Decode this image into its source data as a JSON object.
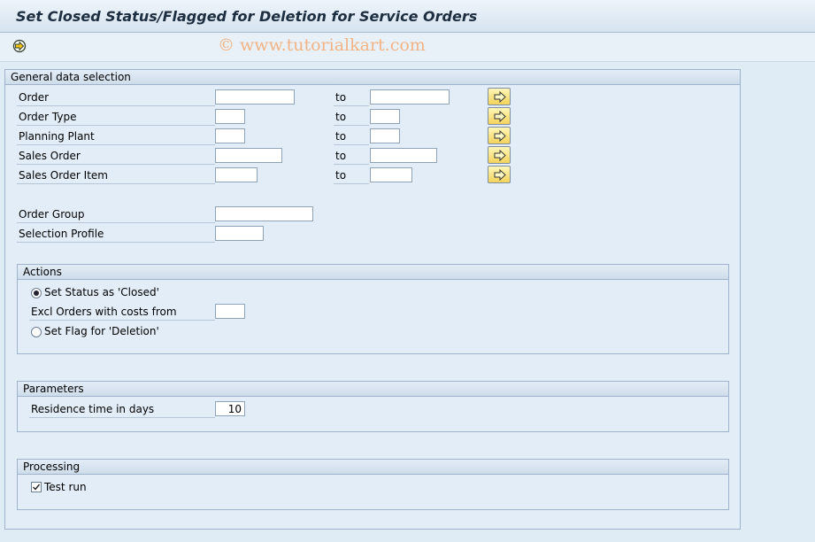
{
  "window": {
    "title": "Set Closed Status/Flagged for Deletion for Service Orders"
  },
  "toolbar": {
    "execute_icon": "execute-icon",
    "watermark": "© www.tutorialkart.com"
  },
  "general": {
    "header": "General data selection",
    "to_label": "to",
    "rows": [
      {
        "label": "Order",
        "low": "",
        "high": ""
      },
      {
        "label": "Order Type",
        "low": "",
        "high": ""
      },
      {
        "label": "Planning Plant",
        "low": "",
        "high": ""
      },
      {
        "label": "Sales Order",
        "low": "",
        "high": ""
      },
      {
        "label": "Sales Order Item",
        "low": "",
        "high": ""
      }
    ],
    "order_group": {
      "label": "Order Group",
      "value": ""
    },
    "selection_profile": {
      "label": "Selection Profile",
      "value": ""
    }
  },
  "actions": {
    "header": "Actions",
    "set_closed": {
      "label": "Set Status as 'Closed'",
      "selected": true
    },
    "excl_costs": {
      "label": "Excl Orders with costs from",
      "value": ""
    },
    "set_deletion": {
      "label": "Set Flag for 'Deletion'",
      "selected": false
    }
  },
  "parameters": {
    "header": "Parameters",
    "residence": {
      "label": "Residence time in days",
      "value": "10"
    }
  },
  "processing": {
    "header": "Processing",
    "test_run": {
      "label": "Test run",
      "checked": true
    }
  }
}
